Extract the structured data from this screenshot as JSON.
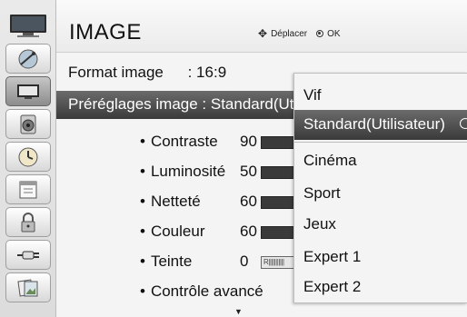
{
  "header": {
    "title": "IMAGE",
    "move_hint": "Déplacer",
    "ok_hint": "OK"
  },
  "sidebar": {
    "items": [
      {
        "icon": "tv-icon"
      },
      {
        "icon": "satellite-dish-icon"
      },
      {
        "icon": "picture-icon",
        "active": true
      },
      {
        "icon": "speaker-icon"
      },
      {
        "icon": "clock-icon"
      },
      {
        "icon": "calendar-icon"
      },
      {
        "icon": "lock-icon"
      },
      {
        "icon": "input-plug-icon"
      },
      {
        "icon": "photo-album-icon"
      }
    ]
  },
  "menu": {
    "format_label": "Format image",
    "format_value": ": 16:9",
    "preset_label": "Préréglages image : Standard(Utilis",
    "settings": [
      {
        "bullet": "•",
        "label": "Contraste",
        "value": "90"
      },
      {
        "bullet": "•",
        "label": "Luminosité",
        "value": "50"
      },
      {
        "bullet": "•",
        "label": "Netteté",
        "value": "60"
      },
      {
        "bullet": "•",
        "label": "Couleur",
        "value": "60"
      },
      {
        "bullet": "•",
        "label": "Teinte",
        "value": "0",
        "bar_text": "R|||||||||||"
      },
      {
        "bullet": "•",
        "label": "Contrôle avancé"
      }
    ],
    "more_arrow": "▼"
  },
  "popup": {
    "options": [
      "Vif",
      "Standard(Utilisateur)",
      "Cinéma",
      "Sport",
      "Jeux",
      "Expert 1",
      "Expert 2"
    ],
    "selected": "Standard(Utilisateur)"
  },
  "colors": {
    "highlight": "#4a4a4a",
    "background": "#f4f4f4"
  }
}
